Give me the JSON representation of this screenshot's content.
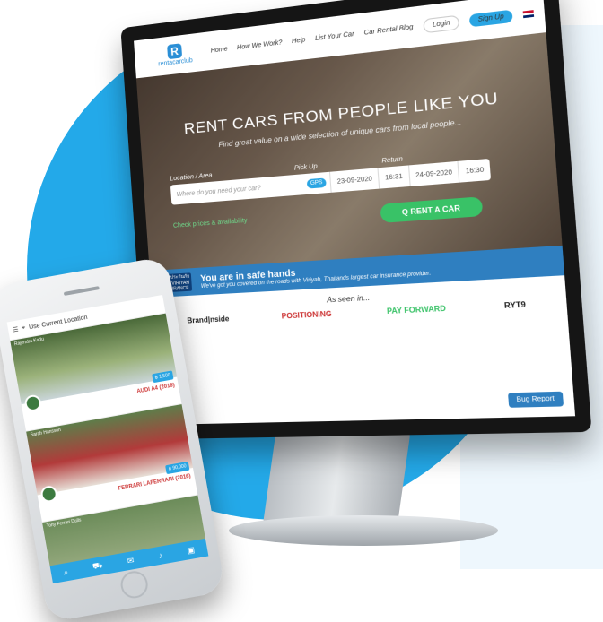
{
  "nav": {
    "logo_text": "rentacarclub",
    "items": [
      "Home",
      "How We Work?",
      "Help",
      "List Your Car",
      "Car Rental Blog"
    ],
    "login": "Login",
    "signup": "Sign Up"
  },
  "hero": {
    "title": "RENT CARS FROM PEOPLE LIKE YOU",
    "subtitle": "Find great value on a wide selection of unique cars from local people...",
    "location_label": "Location / Area",
    "location_placeholder": "Where do you need your car?",
    "gps": "GPS",
    "pickup_label": "Pick Up",
    "pickup_date": "23-09-2020",
    "pickup_time": "16:31",
    "return_label": "Return",
    "return_date": "24-09-2020",
    "return_time": "16:30",
    "rent_button": "Q RENT A CAR",
    "check_note": "Check prices & availability"
  },
  "safe": {
    "insurance_logo": "วิริยะประกันภัย THE VIRIYAH INSURANCE",
    "title": "You are in safe hands",
    "subtitle": "We've got you covered on the roads with Viriyah, Thailands largest car insurance provider."
  },
  "seen": {
    "label": "As seen in...",
    "logos": [
      "Brand|nside",
      "POSITIONING",
      "PAY FORWARD",
      "RYT9"
    ]
  },
  "bug_report": "Bug Report",
  "phone": {
    "header": "Use Current Location",
    "cards": [
      {
        "owner": "Rajendra Kadu",
        "name": "AUDI A4 (2016)",
        "price": "฿ 1,500"
      },
      {
        "owner": "Sarah Hansson",
        "name": "FERRARI LAFERRARI (2016)",
        "price": "฿ 90,000"
      },
      {
        "owner": "Tony Ferrari Dulls",
        "name": "",
        "price": ""
      }
    ]
  }
}
